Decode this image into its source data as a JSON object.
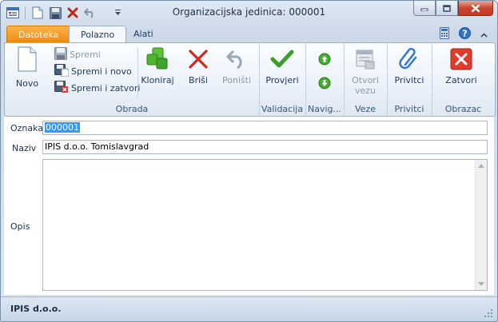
{
  "window": {
    "title": "Organizacijska jedinica: 000001"
  },
  "tabs": {
    "file": "Datoteka",
    "home": "Polazno",
    "tools": "Alati"
  },
  "ribbon": {
    "obrada": {
      "label": "Obrada",
      "novo": "Novo",
      "spremi": "Spremi",
      "spremi_novo": "Spremi i novo",
      "spremi_zatvori": "Spremi i zatvori",
      "kloniraj": "Kloniraj",
      "brisi": "Briši",
      "ponisti": "Poništi"
    },
    "validacija": {
      "label": "Validacija",
      "provjeri": "Provjeri"
    },
    "navigacija": {
      "label": "Navig..."
    },
    "veze": {
      "label": "Veze",
      "otvori_line1": "Otvori",
      "otvori_line2": "vezu"
    },
    "privitci": {
      "label": "Privitci",
      "privitci_btn": "Privitci"
    },
    "obrazac": {
      "label": "Obrazac",
      "zatvori": "Zatvori"
    }
  },
  "form": {
    "oznaka_label": "Oznaka",
    "oznaka_value": "000001",
    "naziv_label": "Naziv",
    "naziv_value": "IPIS d.o.o. Tomislavgrad",
    "opis_label": "Opis",
    "opis_value": ""
  },
  "status": {
    "text": "IPIS d.o.o."
  },
  "colors": {
    "file_tab": "#f08a0f",
    "accent_green": "#3ea52a",
    "delete_red": "#cc2a1e",
    "selection": "#3399ff"
  }
}
